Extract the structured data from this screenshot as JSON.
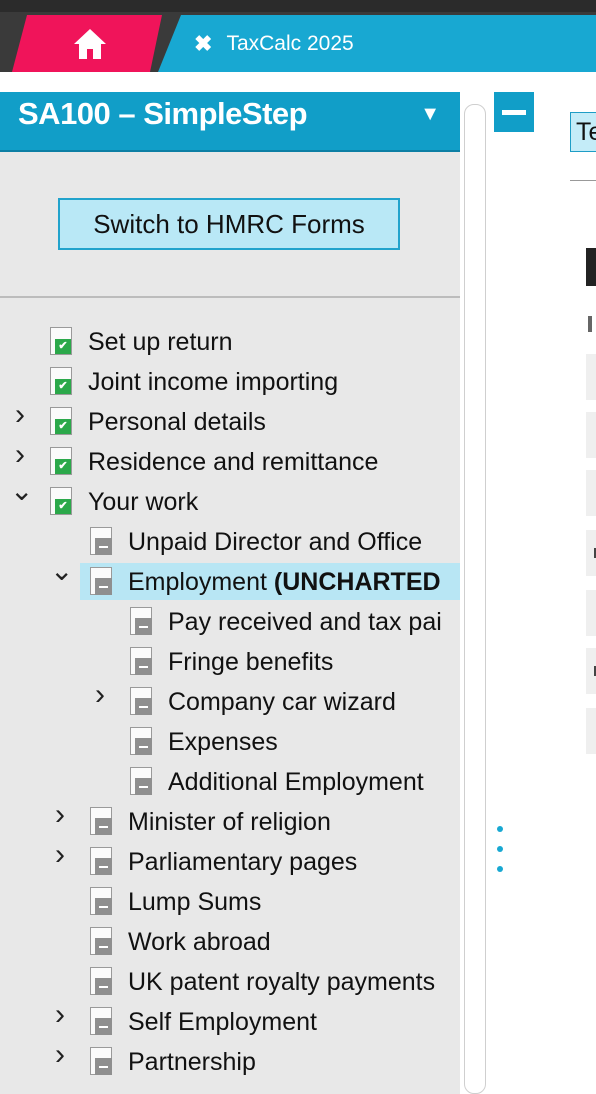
{
  "tabs": {
    "home_icon": "home-icon",
    "app_tab": {
      "close_glyph": "✖",
      "label": "TaxCalc 2025"
    }
  },
  "panel": {
    "title": "SA100 – SimpleStep",
    "dropdown_glyph": "▼",
    "switch_button": "Switch to HMRC Forms"
  },
  "tree": [
    {
      "level": 0,
      "label": "Set up return",
      "status": "complete",
      "chevron": ""
    },
    {
      "level": 0,
      "label": "Joint income importing",
      "status": "complete",
      "chevron": ""
    },
    {
      "level": 0,
      "label": "Personal details",
      "status": "complete",
      "chevron": ">"
    },
    {
      "level": 0,
      "label": "Residence and remittance",
      "status": "complete",
      "chevron": ">"
    },
    {
      "level": 0,
      "label": "Your work",
      "status": "complete",
      "chevron": "v"
    },
    {
      "level": 1,
      "label": "Unpaid Director and Office",
      "status": "pending",
      "chevron": ""
    },
    {
      "level": 1,
      "label": "Employment",
      "suffix": "(UNCHARTED",
      "status": "pending",
      "chevron": "v",
      "selected": true
    },
    {
      "level": 2,
      "label": "Pay received and tax pai",
      "status": "pending",
      "chevron": ""
    },
    {
      "level": 2,
      "label": "Fringe benefits",
      "status": "pending",
      "chevron": ""
    },
    {
      "level": 2,
      "label": "Company car wizard",
      "status": "pending",
      "chevron": ">"
    },
    {
      "level": 2,
      "label": "Expenses",
      "status": "pending",
      "chevron": ""
    },
    {
      "level": 2,
      "label": "Additional Employment",
      "status": "pending",
      "chevron": ""
    },
    {
      "level": 1,
      "label": "Minister of religion",
      "status": "pending",
      "chevron": ">"
    },
    {
      "level": 1,
      "label": "Parliamentary pages",
      "status": "pending",
      "chevron": ">"
    },
    {
      "level": 1,
      "label": "Lump Sums",
      "status": "pending",
      "chevron": ""
    },
    {
      "level": 1,
      "label": "Work abroad",
      "status": "pending",
      "chevron": ""
    },
    {
      "level": 1,
      "label": "UK patent royalty payments",
      "status": "pending",
      "chevron": ""
    },
    {
      "level": 1,
      "label": "Self Employment",
      "status": "pending",
      "chevron": ">"
    },
    {
      "level": 1,
      "label": "Partnership",
      "status": "pending",
      "chevron": ">"
    }
  ],
  "right_pane": {
    "tab_label_fragment": "Te"
  },
  "colors": {
    "home_tab": "#f0145a",
    "accent": "#18a8d2",
    "complete": "#2ba84a",
    "selected_row": "#b8e6f4"
  }
}
